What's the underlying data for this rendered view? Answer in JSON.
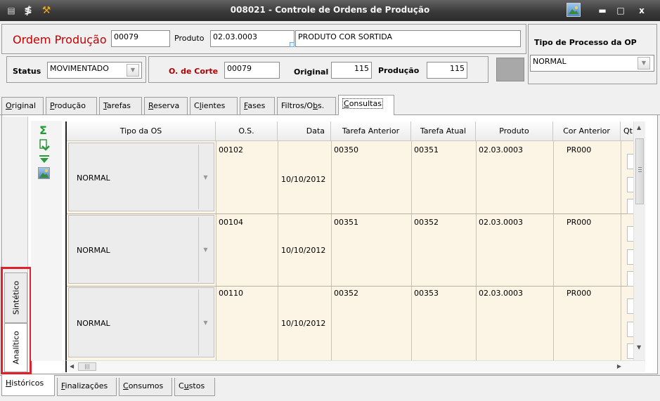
{
  "window": {
    "title": "008021 - Controle de Ordens de Produção",
    "minimize_label": "▬",
    "maximize_label": "□",
    "close_label": "x"
  },
  "header": {
    "ordem_label": "Ordem Produção",
    "ordem_value": "00079",
    "produto_label": "Produto",
    "produto_code": "02.03.0003",
    "produto_desc": "PRODUTO COR SORTIDA",
    "tipo_processo_label": "Tipo de Processo da OP",
    "tipo_processo_value": "NORMAL",
    "status_label": "Status",
    "status_value": "MOVIMENTADO",
    "corte_label": "O. de Corte",
    "corte_value": "00079",
    "original_label": "Original",
    "original_value": "115",
    "producao_label": "Produção",
    "producao_value": "115"
  },
  "tabs": [
    {
      "pre": "",
      "u": "O",
      "post": "riginal"
    },
    {
      "pre": "",
      "u": "P",
      "post": "rodução"
    },
    {
      "pre": "",
      "u": "T",
      "post": "arefas"
    },
    {
      "pre": "",
      "u": "R",
      "post": "eserva"
    },
    {
      "pre": "C",
      "u": "l",
      "post": "ientes"
    },
    {
      "pre": "",
      "u": "F",
      "post": "ases"
    },
    {
      "pre": "Filtros/O",
      "u": "b",
      "post": "s."
    },
    {
      "pre": "",
      "u": "C",
      "post": "onsultas"
    }
  ],
  "side_tabs": {
    "sintetico": "Sintético",
    "analitico": "Analítico"
  },
  "grid": {
    "columns": [
      "Tipo da OS",
      "O.S.",
      "Data",
      "Tarefa Anterior",
      "Tarefa Atual",
      "Produto",
      "Cor Anterior",
      "Qt"
    ],
    "rows": [
      {
        "tipo": "NORMAL",
        "os": "00102",
        "data": "10/10/2012",
        "tarefa_ant": "00350",
        "tarefa_atual": "00351",
        "produto": "02.03.0003",
        "cor_ant": "PR000"
      },
      {
        "tipo": "NORMAL",
        "os": "00104",
        "data": "10/10/2012",
        "tarefa_ant": "00351",
        "tarefa_atual": "00352",
        "produto": "02.03.0003",
        "cor_ant": "PR000"
      },
      {
        "tipo": "NORMAL",
        "os": "00110",
        "data": "10/10/2012",
        "tarefa_ant": "00352",
        "tarefa_atual": "00353",
        "produto": "02.03.0003",
        "cor_ant": "PR000"
      }
    ]
  },
  "bottom_tabs": [
    {
      "pre": "",
      "u": "H",
      "post": "istóricos"
    },
    {
      "pre": "",
      "u": "F",
      "post": "inalizações"
    },
    {
      "pre": "",
      "u": "C",
      "post": "onsumos"
    },
    {
      "pre": "C",
      "u": "u",
      "post": "stos"
    }
  ],
  "colors": {
    "ordem_label": "#c40000",
    "corte_label": "#b00000",
    "grid_bg": "#fcf4e4",
    "highlight": "#e0202a"
  }
}
